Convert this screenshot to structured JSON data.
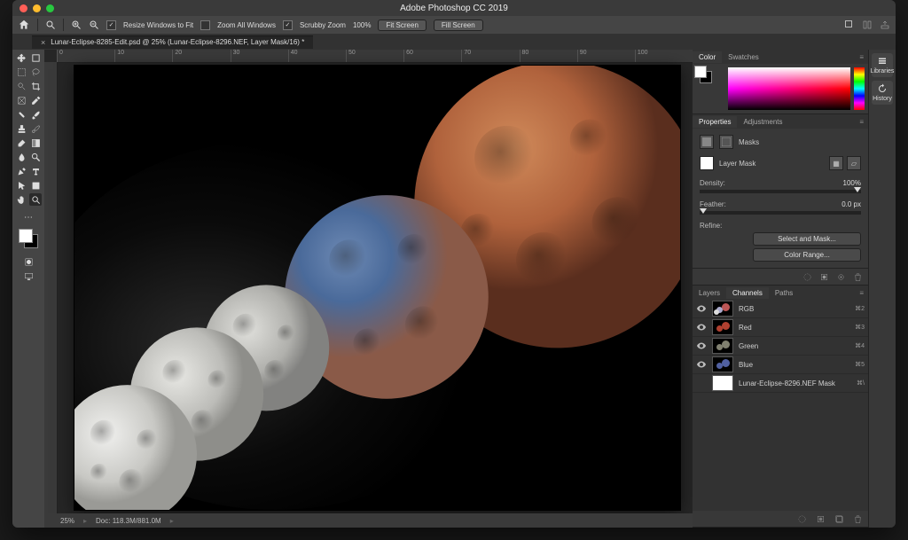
{
  "app": {
    "title": "Adobe Photoshop CC 2019"
  },
  "window_controls": {
    "close": "#ff5f57",
    "min": "#febc2e",
    "max": "#28c840"
  },
  "options_bar": {
    "resize_windows": "Resize Windows to Fit",
    "zoom_all": "Zoom All Windows",
    "scrubby": "Scrubby Zoom",
    "zoom_value": "100%",
    "fit_screen": "Fit Screen",
    "fill_screen": "Fill Screen"
  },
  "document": {
    "tab": "Lunar-Eclipse-8285-Edit.psd @ 25% (Lunar-Eclipse-8296.NEF, Layer Mask/16) *"
  },
  "ruler_marks": [
    "0",
    "10",
    "20",
    "30",
    "40",
    "50",
    "60",
    "70",
    "80",
    "90",
    "100"
  ],
  "status": {
    "zoom": "25%",
    "doc": "Doc: 118.3M/881.0M"
  },
  "dock": {
    "libraries": "Libraries",
    "history": "History"
  },
  "panels": {
    "color_tab": "Color",
    "swatches_tab": "Swatches",
    "properties_tab": "Properties",
    "adjustments_tab": "Adjustments",
    "masks_label": "Masks",
    "layer_mask": "Layer Mask",
    "density_label": "Density:",
    "density_value": "100%",
    "feather_label": "Feather:",
    "feather_value": "0.0 px",
    "refine_label": "Refine:",
    "select_mask_btn": "Select and Mask...",
    "color_range_btn": "Color Range...",
    "layers_tab": "Layers",
    "channels_tab": "Channels",
    "paths_tab": "Paths"
  },
  "channels": [
    {
      "name": "RGB",
      "shortcut": "⌘2",
      "tint": "mix"
    },
    {
      "name": "Red",
      "shortcut": "⌘3",
      "tint": "#b04030"
    },
    {
      "name": "Green",
      "shortcut": "⌘4",
      "tint": "#808070"
    },
    {
      "name": "Blue",
      "shortcut": "⌘5",
      "tint": "#5060a0"
    },
    {
      "name": "Lunar-Eclipse-8296.NEF Mask",
      "shortcut": "⌘\\",
      "tint": "mask"
    }
  ],
  "foreground": "#ffffff",
  "background": "#000000"
}
